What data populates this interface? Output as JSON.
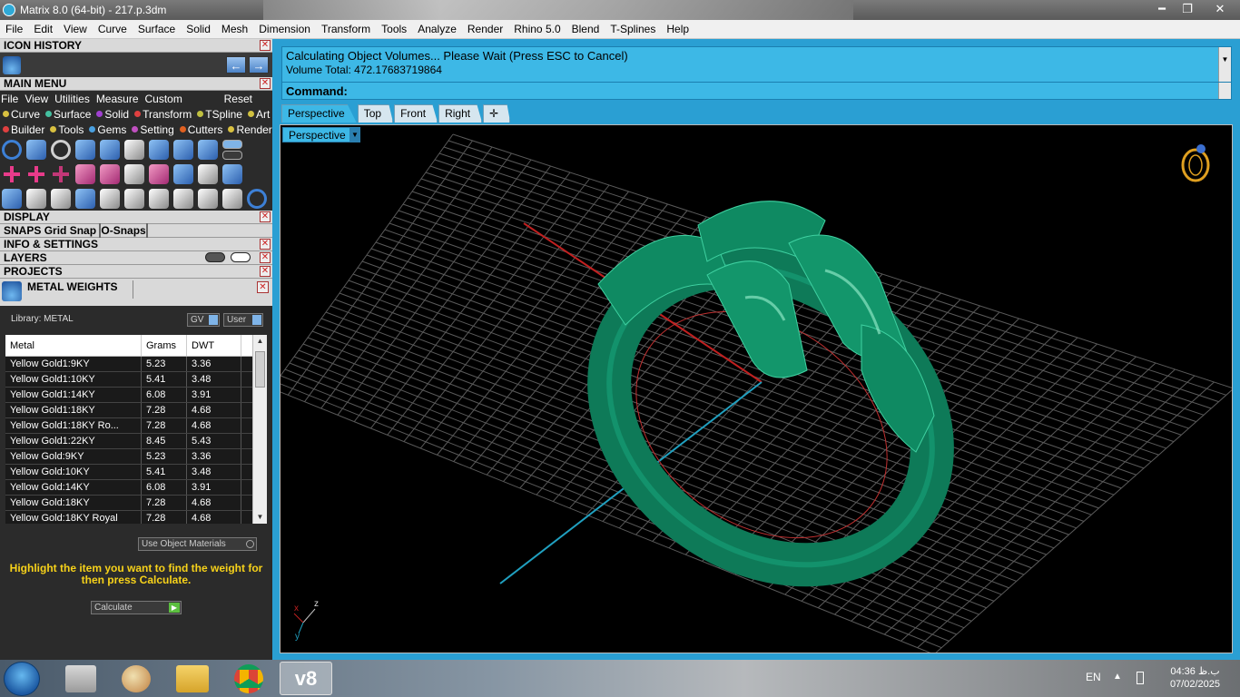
{
  "window": {
    "title": "Matrix 8.0 (64-bit) - 217.p.3dm",
    "buttons": {
      "minimize": "━",
      "maximize": "❐",
      "close": "✕"
    }
  },
  "menubar": [
    "File",
    "Edit",
    "View",
    "Curve",
    "Surface",
    "Solid",
    "Mesh",
    "Dimension",
    "Transform",
    "Tools",
    "Analyze",
    "Render",
    "Rhino 5.0",
    "Blend",
    "T-Splines",
    "Help"
  ],
  "left_panel": {
    "icon_history": {
      "title": "ICON HISTORY",
      "back": "←",
      "forward": "→"
    },
    "main_menu": {
      "title": "MAIN MENU",
      "menus": [
        "File",
        "View",
        "Utilities",
        "Measure",
        "Custom"
      ],
      "reset": "Reset",
      "categories_row1": [
        {
          "label": "Curve",
          "color": "#d8c040"
        },
        {
          "label": "Surface",
          "color": "#44c0a0"
        },
        {
          "label": "Solid",
          "color": "#a040d0"
        },
        {
          "label": "Transform",
          "color": "#e04040"
        },
        {
          "label": "TSpline",
          "color": "#c0c040"
        },
        {
          "label": "Art",
          "color": "#d0c040"
        }
      ],
      "categories_row2": [
        {
          "label": "Builder",
          "color": "#e04040"
        },
        {
          "label": "Tools",
          "color": "#d8c040"
        },
        {
          "label": "Gems",
          "color": "#4aa0e0"
        },
        {
          "label": "Setting",
          "color": "#c050c0"
        },
        {
          "label": "Cutters",
          "color": "#e06020"
        },
        {
          "label": "Render",
          "color": "#d8c040"
        }
      ]
    },
    "sections": {
      "display": "DISPLAY",
      "snaps": "SNAPS",
      "grid_snap": "Grid Snap",
      "o_snaps": "O-Snaps",
      "info": "INFO & SETTINGS",
      "layers": "LAYERS",
      "projects": "PROJECTS"
    },
    "metal_weights": {
      "title": "METAL WEIGHTS",
      "library": "Library: METAL",
      "gv_btn": "GV",
      "user_btn": "User",
      "columns": [
        "Metal",
        "Grams",
        "DWT"
      ],
      "rows": [
        [
          "Yellow Gold1:9KY",
          "5.23",
          "3.36"
        ],
        [
          "Yellow Gold1:10KY",
          "5.41",
          "3.48"
        ],
        [
          "Yellow Gold1:14KY",
          "6.08",
          "3.91"
        ],
        [
          "Yellow Gold1:18KY",
          "7.28",
          "4.68"
        ],
        [
          "Yellow Gold1:18KY Ro...",
          "7.28",
          "4.68"
        ],
        [
          "Yellow Gold1:22KY",
          "8.45",
          "5.43"
        ],
        [
          "Yellow Gold:9KY",
          "5.23",
          "3.36"
        ],
        [
          "Yellow Gold:10KY",
          "5.41",
          "3.48"
        ],
        [
          "Yellow Gold:14KY",
          "6.08",
          "3.91"
        ],
        [
          "Yellow Gold:18KY",
          "7.28",
          "4.68"
        ],
        [
          "Yellow Gold:18KY Royal",
          "7.28",
          "4.68"
        ]
      ],
      "use_object_materials": "Use Object Materials",
      "hint": "Highlight the item you want to find the weight for then press Calculate.",
      "calculate": "Calculate"
    }
  },
  "command": {
    "line1": "Calculating Object Volumes... Please Wait (Press ESC to Cancel)",
    "line2": "Volume Total: 472.17683719864",
    "prompt": "Command:"
  },
  "viewport_tabs": [
    "Perspective",
    "Top",
    "Front",
    "Right",
    "✛"
  ],
  "viewport": {
    "label": "Perspective",
    "axis_labels": {
      "x": "x",
      "y": "y",
      "z": "z"
    },
    "colors": {
      "background": "#000000",
      "grid": "#5a5a5a",
      "ring": "#0f7a5a",
      "x_axis": "#c02020",
      "y_axis": "#20a0c0"
    }
  },
  "taskbar": {
    "lang": "EN",
    "time": "04:36 ب.ظ",
    "date": "07/02/2025",
    "apps": [
      "start-icon",
      "calculator-icon",
      "paint-icon",
      "explorer-icon",
      "chrome-icon",
      "matrix-v8-icon"
    ]
  }
}
